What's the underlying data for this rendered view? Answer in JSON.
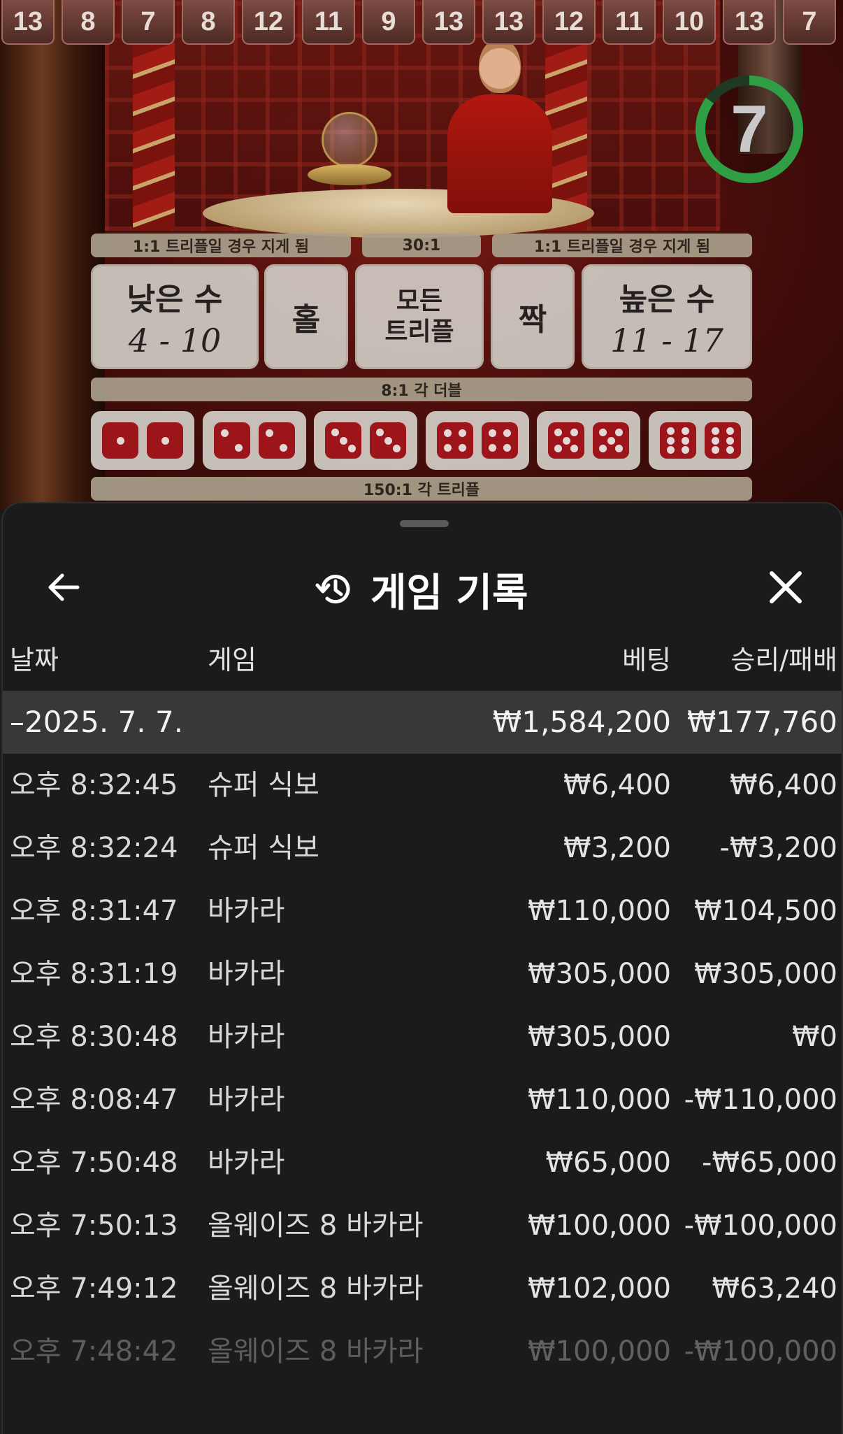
{
  "game_view": {
    "history_numbers": [
      "13",
      "8",
      "7",
      "8",
      "12",
      "11",
      "9",
      "13",
      "13",
      "12",
      "11",
      "10",
      "13",
      "7"
    ],
    "timer": {
      "value": "7",
      "fraction_remaining": 0.85,
      "color": "#2f9e44"
    },
    "payout_bars": {
      "low_high_note_left": "1:1 트리플일 경우 지게 됨",
      "triple_any": "30:1",
      "low_high_note_right": "1:1 트리플일 경우 지게 됨",
      "doubles": "8:1 각 더블",
      "triples": "150:1 각 트리플"
    },
    "bet_areas": {
      "low_label": "낮은 수",
      "low_range": "4 - 10",
      "odd": "홀",
      "any_triple_line1": "모든",
      "any_triple_line2": "트리플",
      "even": "짝",
      "high_label": "높은 수",
      "high_range": "11 - 17"
    },
    "double_values": [
      1,
      2,
      3,
      4,
      5,
      6
    ],
    "die_color": "#a4161c"
  },
  "sheet": {
    "title": "게임 기록",
    "back_icon": "arrow-left-icon",
    "history_icon": "history-clock-icon",
    "close_icon": "close-icon",
    "columns": {
      "date": "날짜",
      "game": "게임",
      "bet": "베팅",
      "win_loss": "승리/패배"
    },
    "date_group": {
      "date": "–2025. 7. 7.",
      "bet_total": "₩1,584,200",
      "win_total": "₩177,760"
    },
    "rows": [
      {
        "time": "오후 8:32:45",
        "game": "슈퍼 식보",
        "bet": "₩6,400",
        "result": "₩6,400"
      },
      {
        "time": "오후 8:32:24",
        "game": "슈퍼 식보",
        "bet": "₩3,200",
        "result": "-₩3,200"
      },
      {
        "time": "오후 8:31:47",
        "game": "바카라",
        "bet": "₩110,000",
        "result": "₩104,500"
      },
      {
        "time": "오후 8:31:19",
        "game": "바카라",
        "bet": "₩305,000",
        "result": "₩305,000"
      },
      {
        "time": "오후 8:30:48",
        "game": "바카라",
        "bet": "₩305,000",
        "result": "₩0"
      },
      {
        "time": "오후 8:08:47",
        "game": "바카라",
        "bet": "₩110,000",
        "result": "-₩110,000"
      },
      {
        "time": "오후 7:50:48",
        "game": "바카라",
        "bet": "₩65,000",
        "result": "-₩65,000"
      },
      {
        "time": "오후 7:50:13",
        "game": "올웨이즈 8 바카라",
        "bet": "₩100,000",
        "result": "-₩100,000"
      },
      {
        "time": "오후 7:49:12",
        "game": "올웨이즈 8 바카라",
        "bet": "₩102,000",
        "result": "₩63,240"
      },
      {
        "time": "오후 7:48:42",
        "game": "올웨이즈 8 바카라",
        "bet": "₩100,000",
        "result": "-₩100,000"
      }
    ]
  }
}
